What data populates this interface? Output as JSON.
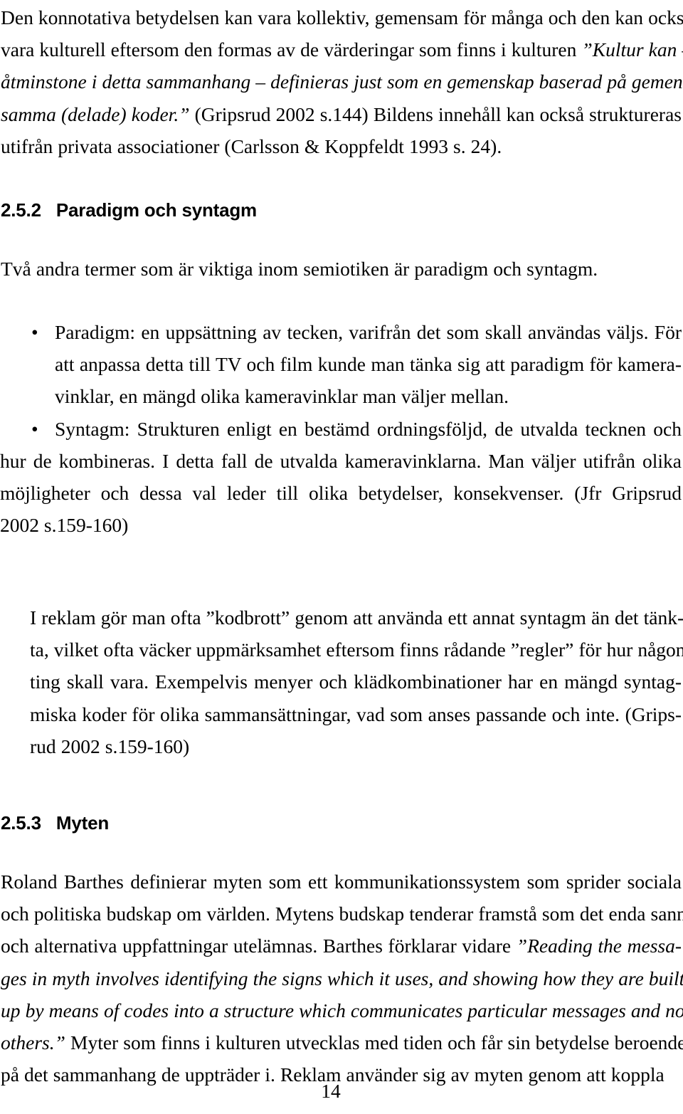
{
  "document": {
    "language": "sv",
    "page_number": "14"
  },
  "intro_paragraph": {
    "lines": [
      [
        {
          "text": "Den konnotativa betydelsen kan vara kollektiv, gemensam för många och den kan också",
          "style": "roman"
        }
      ],
      [
        {
          "text": "vara kulturell eftersom den formas av de värderingar som finns i kulturen ",
          "style": "roman"
        },
        {
          "text": "”Kultur kan –",
          "style": "italic"
        }
      ],
      [
        {
          "text": "åtminstone i detta sammanhang – definieras just som en gemenskap baserad på gemen-",
          "style": "italic"
        }
      ],
      [
        {
          "text": "samma (delade) koder.”",
          "style": "italic"
        },
        {
          "text": " (Gripsrud 2002 s.144) Bildens innehåll kan också struktureras",
          "style": "roman"
        }
      ],
      [
        {
          "text": "utifrån privata associationer (Carlsson & Koppfeldt 1993 s. 24).",
          "style": "roman"
        }
      ]
    ]
  },
  "heading_paradigm": {
    "number": "2.5.2",
    "title": "Paradigm och syntagm",
    "full": "2.5.2   Paradigm och syntagm"
  },
  "paradigm_intro": {
    "lines": [
      [
        {
          "text": "Två andra termer som är viktiga inom semiotiken är paradigm och syntagm.",
          "style": "roman"
        }
      ]
    ]
  },
  "bullets": [
    {
      "marker": "•",
      "indent_continuation": true,
      "lines": [
        [
          {
            "text": "Paradigm: en uppsättning av tecken, varifrån det som skall användas väljs. För",
            "style": "roman"
          }
        ],
        [
          {
            "text": "att anpassa detta till TV och film kunde man tänka sig att paradigm för kamera-",
            "style": "roman"
          }
        ],
        [
          {
            "text": "vinklar, en mängd olika kameravinklar man väljer mellan.",
            "style": "roman"
          }
        ]
      ]
    },
    {
      "marker": "•",
      "indent_continuation": false,
      "lines": [
        [
          {
            "text": "Syntagm: Strukturen enligt en bestämd ordningsföljd, de utvalda tecknen och",
            "style": "roman"
          }
        ],
        [
          {
            "text": "hur de kombineras. I detta fall de utvalda kameravinklarna. Man väljer utifrån olika",
            "style": "roman"
          }
        ],
        [
          {
            "text": "möjligheter och dessa val leder till olika betydelser, konsekvenser. (Jfr Gripsrud",
            "style": "roman"
          }
        ],
        [
          {
            "text": "2002 s.159-160)",
            "style": "roman"
          }
        ]
      ]
    }
  ],
  "closing_paragraph": {
    "lines": [
      [
        {
          "text": "I reklam gör man ofta ”kodbrott” genom att använda ett annat syntagm än det tänk-",
          "style": "roman"
        }
      ],
      [
        {
          "text": "ta, vilket ofta väcker uppmärksamhet eftersom finns rådande ”regler” för hur någon-",
          "style": "roman"
        }
      ],
      [
        {
          "text": "ting skall vara. Exempelvis menyer och klädkombinationer har en mängd syntag-",
          "style": "roman"
        }
      ],
      [
        {
          "text": "miska koder för olika sammansättningar, vad som anses passande och inte. (Grips-",
          "style": "roman"
        }
      ],
      [
        {
          "text": "rud 2002 s.159-160)",
          "style": "roman"
        }
      ]
    ]
  },
  "heading_myten": {
    "number": "2.5.3",
    "title": "Myten",
    "full": "2.5.3   Myten"
  },
  "myten_paragraph": {
    "lines": [
      [
        {
          "text": "Roland Barthes definierar myten som ett kommunikationssystem som sprider sociala",
          "style": "roman"
        }
      ],
      [
        {
          "text": "och politiska budskap om världen. Mytens budskap tenderar framstå som det enda sanna",
          "style": "roman"
        }
      ],
      [
        {
          "text": "och alternativa uppfattningar utelämnas. Barthes förklarar vidare ",
          "style": "roman"
        },
        {
          "text": "”Reading the messa-",
          "style": "italic"
        }
      ],
      [
        {
          "text": "ges in myth involves identifying the signs which it uses, and showing how they are built",
          "style": "italic"
        }
      ],
      [
        {
          "text": "up by means of codes into a structure which communicates particular messages and not",
          "style": "italic"
        }
      ],
      [
        {
          "text": "others.”",
          "style": "italic"
        },
        {
          "text": " Myter som finns i kulturen utvecklas med tiden och får sin betydelse beroende",
          "style": "roman"
        }
      ],
      [
        {
          "text": "på det sammanhang de uppträder i. Reklam använder sig av myten genom att koppla",
          "style": "roman"
        }
      ]
    ]
  }
}
